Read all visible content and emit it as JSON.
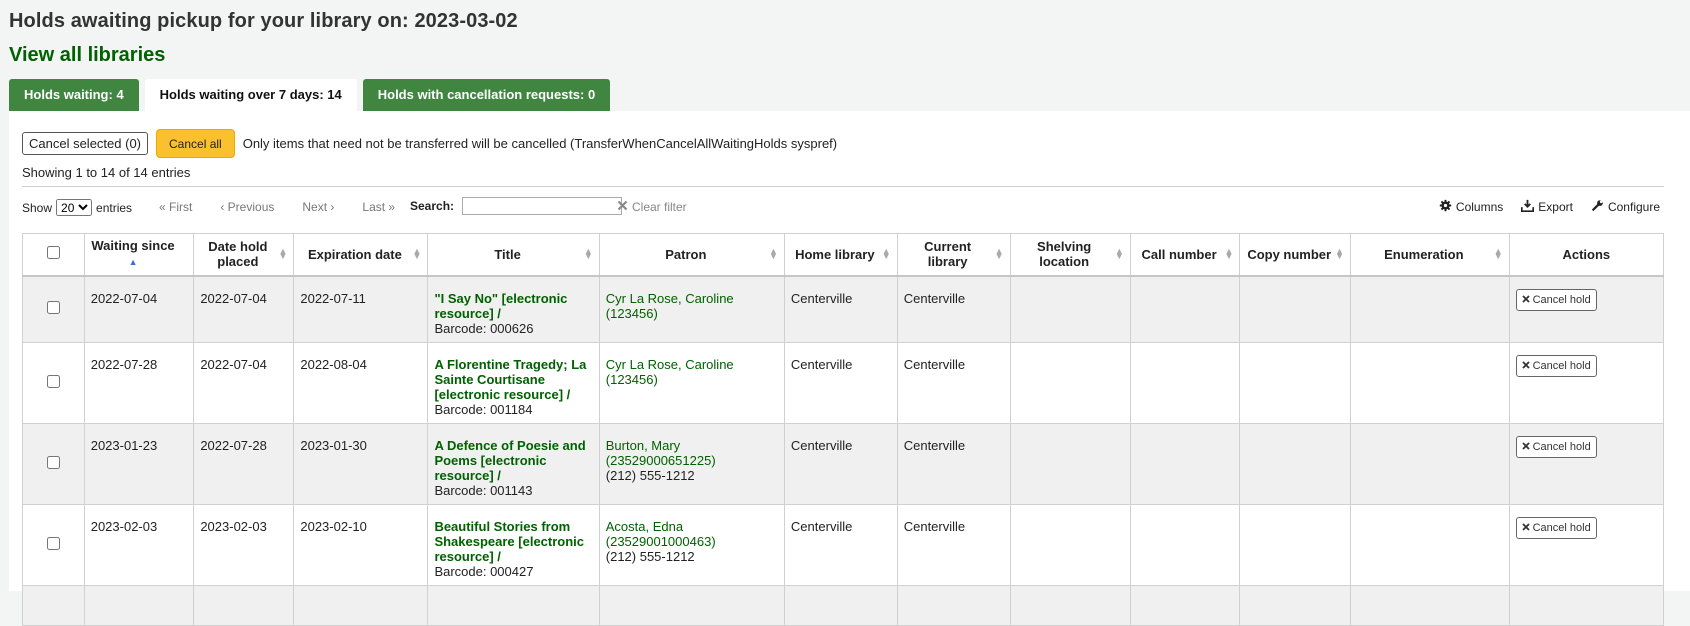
{
  "page": {
    "title": "Holds awaiting pickup for your library on: 2023-03-02",
    "view_all": "View all libraries"
  },
  "tabs": [
    {
      "label": "Holds waiting: 4"
    },
    {
      "label": "Holds waiting over 7 days: 14"
    },
    {
      "label": "Holds with cancellation requests: 0"
    }
  ],
  "actions": {
    "cancel_selected": "Cancel selected (0)",
    "cancel_all": "Cancel all",
    "note": "Only items that need not be transferred will be cancelled (TransferWhenCancelAllWaitingHolds syspref)"
  },
  "info": "Showing 1 to 14 of 14 entries",
  "toolbar": {
    "show_label": "Show",
    "show_value": "20",
    "entries_label": "entries",
    "first": "« First",
    "previous": "‹ Previous",
    "next": "Next ›",
    "last": "Last »",
    "search_label": "Search:",
    "search_value": "",
    "clear_filter": "Clear filter",
    "columns": "Columns",
    "export": "Export",
    "configure": "Configure"
  },
  "table": {
    "headers": {
      "waiting_since": "Waiting since",
      "date_placed": "Date hold placed",
      "expiration": "Expiration date",
      "title": "Title",
      "patron": "Patron",
      "home_library": "Home library",
      "current_library": "Current library",
      "shelving": "Shelving location",
      "call_number": "Call number",
      "copy_number": "Copy number",
      "enumeration": "Enumeration",
      "actions": "Actions"
    },
    "cancel_hold_label": "Cancel hold",
    "rows": [
      {
        "waiting_since": "2022-07-04",
        "date_placed": "2022-07-04",
        "expiration": "2022-07-11",
        "title": "\"I Say No\" [electronic resource] /",
        "barcode": "Barcode: 000626",
        "patron": "Cyr La Rose, Caroline (123456)",
        "phone": "",
        "home_library": "Centerville",
        "current_library": "Centerville",
        "shelving": "",
        "call_number": "",
        "copy_number": "",
        "enumeration": ""
      },
      {
        "waiting_since": "2022-07-28",
        "date_placed": "2022-07-04",
        "expiration": "2022-08-04",
        "title": "A Florentine Tragedy; La Sainte Courtisane [electronic resource] /",
        "barcode": "Barcode: 001184",
        "patron": "Cyr La Rose, Caroline (123456)",
        "phone": "",
        "home_library": "Centerville",
        "current_library": "Centerville",
        "shelving": "",
        "call_number": "",
        "copy_number": "",
        "enumeration": ""
      },
      {
        "waiting_since": "2023-01-23",
        "date_placed": "2022-07-28",
        "expiration": "2023-01-30",
        "title": "A Defence of Poesie and Poems [electronic resource] /",
        "barcode": "Barcode: 001143",
        "patron": "Burton, Mary (23529000651225)",
        "phone": "(212) 555-1212",
        "home_library": "Centerville",
        "current_library": "Centerville",
        "shelving": "",
        "call_number": "",
        "copy_number": "",
        "enumeration": ""
      },
      {
        "waiting_since": "2023-02-03",
        "date_placed": "2023-02-03",
        "expiration": "2023-02-10",
        "title": "Beautiful Stories from Shakespeare [electronic resource] /",
        "barcode": "Barcode: 000427",
        "patron": "Acosta, Edna (23529001000463)",
        "phone": "(212) 555-1212",
        "home_library": "Centerville",
        "current_library": "Centerville",
        "shelving": "",
        "call_number": "",
        "copy_number": "",
        "enumeration": ""
      },
      {
        "waiting_since": "",
        "date_placed": "",
        "expiration": "",
        "title": "",
        "barcode": "",
        "patron": "",
        "phone": "",
        "home_library": "",
        "current_library": "",
        "shelving": "",
        "call_number": "",
        "copy_number": "",
        "enumeration": ""
      }
    ]
  }
}
